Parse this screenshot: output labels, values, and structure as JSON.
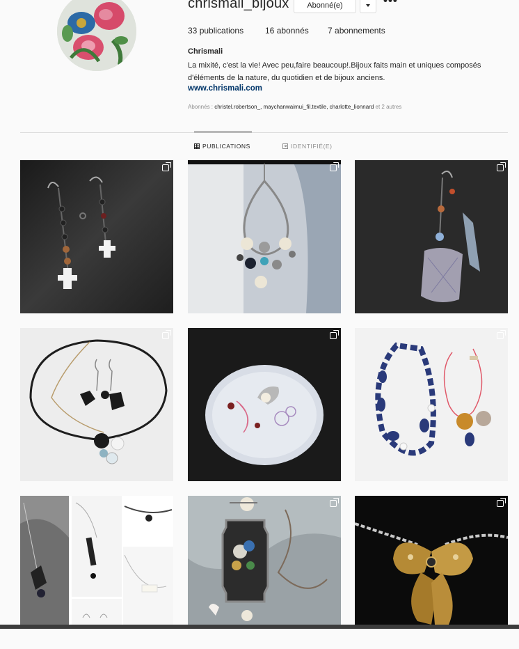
{
  "profile": {
    "username": "chrismali_bijoux",
    "follow_button": "Abonné(e)",
    "stats": {
      "posts": "33",
      "posts_label": "publications",
      "followers": "16",
      "followers_label": "abonnés",
      "following": "7",
      "following_label": "abonnements"
    },
    "full_name": "Chrismali",
    "bio": "La mixité, c'est la vie! Avec peu,faire beaucoup!.Bijoux faits main et uniques composés d'éléments de la nature, du quotidien et de bijoux anciens.",
    "website": "www.chrismali.com",
    "followed_by_label": "Abonnés :",
    "followed_by_names": "christel.robertson_, maychanwaimui_fil.textile, charlotte_lionnard",
    "followed_by_more": "et 2 autres"
  },
  "tabs": {
    "publications": "PUBLICATIONS",
    "tagged": "IDENTIFIÉ(E)"
  },
  "posts": [
    {
      "icon": "multi-photo-icon"
    },
    {
      "icon": "multi-photo-icon"
    },
    {
      "icon": "multi-photo-icon"
    },
    {
      "icon": "multi-photo-icon"
    },
    {
      "icon": "multi-photo-icon"
    },
    {
      "icon": "multi-photo-icon"
    },
    {
      "icon": "multi-photo-icon"
    },
    {
      "icon": "multi-photo-icon"
    },
    {
      "icon": "multi-photo-icon"
    }
  ],
  "colors": {
    "text": "#262626",
    "muted": "#8e8e8e",
    "link": "#003569",
    "border": "#dbdbdb",
    "background": "#fafafa"
  }
}
